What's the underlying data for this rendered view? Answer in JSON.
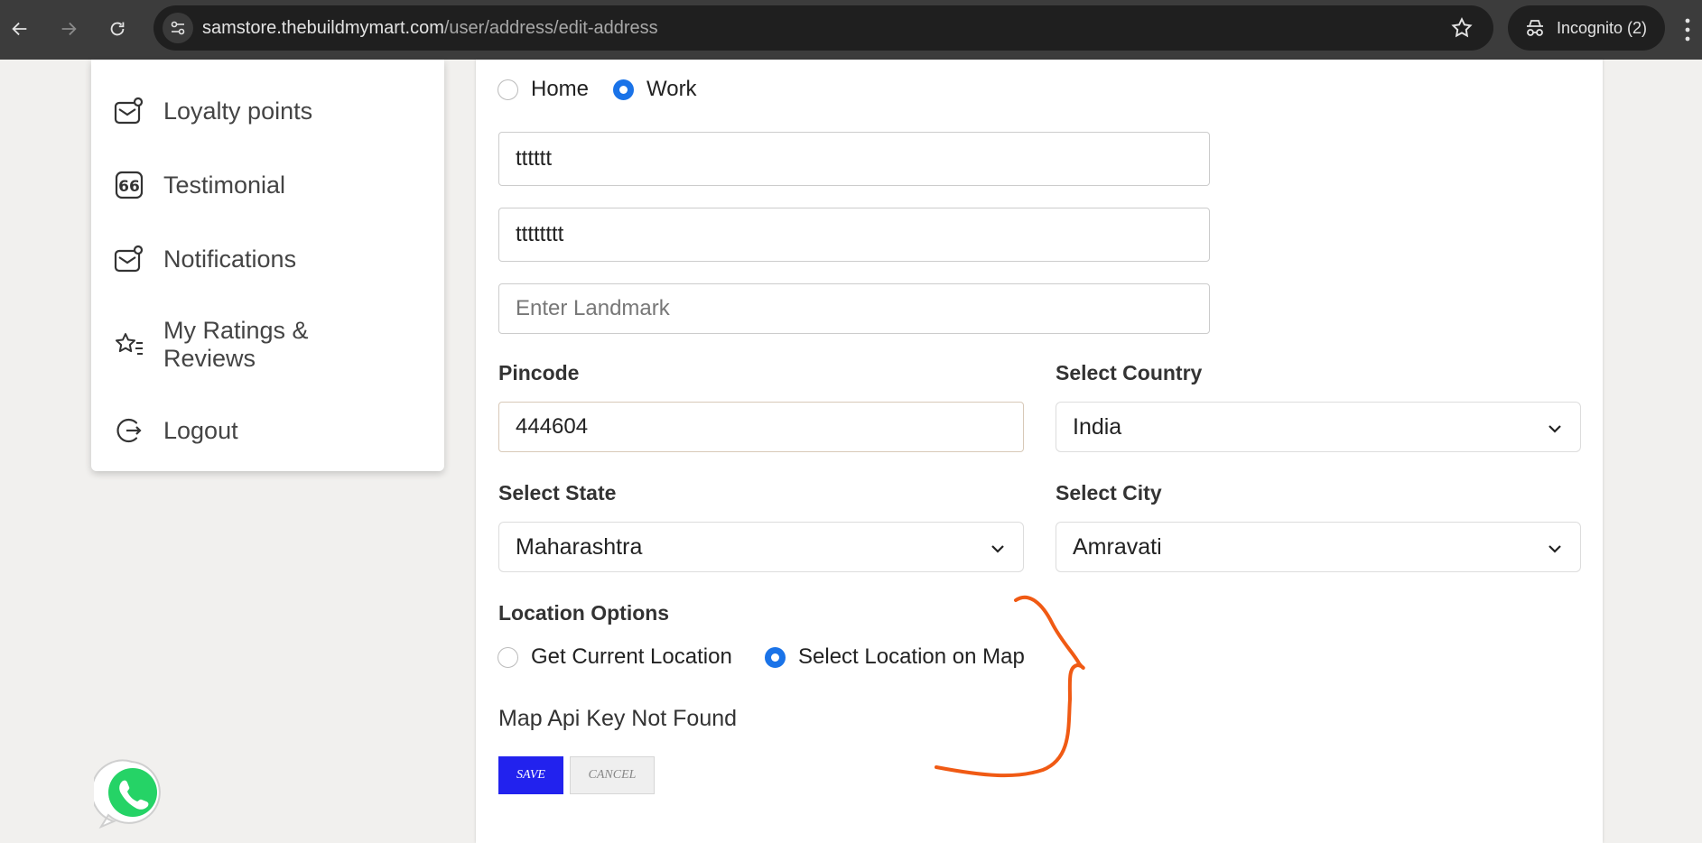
{
  "browser": {
    "url_host": "samstore.thebuildmymart.com",
    "url_path": "/user/address/edit-address",
    "incognito_label": "Incognito (2)"
  },
  "sidebar": {
    "items": [
      {
        "label": "Loyalty points",
        "icon": "mail-badge-icon"
      },
      {
        "label": "Testimonial",
        "icon": "quote-icon"
      },
      {
        "label": "Notifications",
        "icon": "mail-badge-icon"
      },
      {
        "label": "My Ratings & Reviews",
        "icon": "star-list-icon"
      },
      {
        "label": "Logout",
        "icon": "logout-icon"
      }
    ]
  },
  "form": {
    "address_type": {
      "options": [
        "Home",
        "Work"
      ],
      "selected": "Work"
    },
    "address_line1": "tttttt",
    "address_line2": "tttttttt",
    "landmark_placeholder": "Enter Landmark",
    "pincode_label": "Pincode",
    "pincode_value": "444604",
    "country_label": "Select Country",
    "country_value": "India",
    "state_label": "Select State",
    "state_value": "Maharashtra",
    "city_label": "Select City",
    "city_value": "Amravati",
    "location_options_label": "Location Options",
    "location_options": [
      "Get Current Location",
      "Select Location on Map"
    ],
    "location_selected": "Select Location on Map",
    "map_message": "Map Api Key Not Found",
    "save_label": "SAVE",
    "cancel_label": "CANCEL"
  },
  "colors": {
    "accent": "#1a73e8",
    "save_button": "#2222ee",
    "annotation": "#f05a14",
    "whatsapp": "#25d366"
  }
}
